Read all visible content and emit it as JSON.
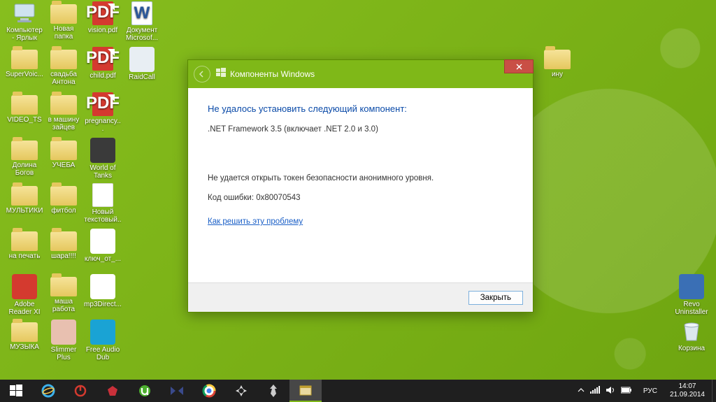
{
  "desktop_icons": [
    {
      "col": 0,
      "row": 0,
      "type": "pc",
      "label": "Компьютер - Ярлык",
      "name": "desktop-icon-computer"
    },
    {
      "col": 1,
      "row": 0,
      "type": "folder",
      "label": "Новая папка",
      "name": "desktop-icon-new-folder"
    },
    {
      "col": 2,
      "row": 0,
      "type": "pdf",
      "label": "vision.pdf",
      "name": "desktop-icon-vision-pdf"
    },
    {
      "col": 3,
      "row": 0,
      "type": "doc",
      "label": "Документ Microsof...",
      "name": "desktop-icon-word-doc"
    },
    {
      "col": 0,
      "row": 1,
      "type": "folder",
      "label": "SuperVoic...",
      "name": "desktop-icon-supervoice"
    },
    {
      "col": 1,
      "row": 1,
      "type": "folder",
      "label": "свадьба Антона",
      "name": "desktop-icon-wedding"
    },
    {
      "col": 2,
      "row": 1,
      "type": "pdf",
      "label": "child.pdf",
      "name": "desktop-icon-child-pdf"
    },
    {
      "col": 3,
      "row": 1,
      "type": "app",
      "label": "RaidCall",
      "name": "desktop-icon-raidcall",
      "bg": "#e8eef3"
    },
    {
      "col": 0,
      "row": 2,
      "type": "folder",
      "label": "VIDEO_TS",
      "name": "desktop-icon-video-ts"
    },
    {
      "col": 1,
      "row": 2,
      "type": "folder",
      "label": "в машину зайцев",
      "name": "desktop-icon-car"
    },
    {
      "col": 2,
      "row": 2,
      "type": "pdf",
      "label": "pregnancy...",
      "name": "desktop-icon-pregnancy-pdf"
    },
    {
      "col": 0,
      "row": 3,
      "type": "folder",
      "label": "Долина Богов",
      "name": "desktop-icon-valley"
    },
    {
      "col": 1,
      "row": 3,
      "type": "folder",
      "label": "УЧЕБА",
      "name": "desktop-icon-study"
    },
    {
      "col": 2,
      "row": 3,
      "type": "app",
      "label": "World of Tanks",
      "name": "desktop-icon-wot",
      "bg": "#3a3a3a"
    },
    {
      "col": 0,
      "row": 4,
      "type": "folder",
      "label": "МУЛЬТИКИ",
      "name": "desktop-icon-cartoons"
    },
    {
      "col": 1,
      "row": 4,
      "type": "folder",
      "label": "фитбол",
      "name": "desktop-icon-fitball"
    },
    {
      "col": 2,
      "row": 4,
      "type": "txt",
      "label": "Новый текстовый...",
      "name": "desktop-icon-txt"
    },
    {
      "col": 0,
      "row": 5,
      "type": "folder",
      "label": "на печать",
      "name": "desktop-icon-print"
    },
    {
      "col": 1,
      "row": 5,
      "type": "folder",
      "label": "шара!!!!",
      "name": "desktop-icon-shara"
    },
    {
      "col": 2,
      "row": 5,
      "type": "app",
      "label": "ключ_от_...",
      "name": "desktop-icon-key",
      "bg": "#fff"
    },
    {
      "col": 0,
      "row": 6,
      "type": "app",
      "label": "Adobe Reader XI",
      "name": "desktop-icon-adobe",
      "bg": "#d43a2f"
    },
    {
      "col": 1,
      "row": 6,
      "type": "folder",
      "label": "маша работа",
      "name": "desktop-icon-masha"
    },
    {
      "col": 2,
      "row": 6,
      "type": "app",
      "label": "mp3Direct...",
      "name": "desktop-icon-mp3",
      "bg": "#fff"
    },
    {
      "col": 0,
      "row": 7,
      "type": "folder",
      "label": "МУЗЫКА",
      "name": "desktop-icon-music"
    },
    {
      "col": 1,
      "row": 7,
      "type": "app",
      "label": "Slimmer Plus",
      "name": "desktop-icon-slimmer",
      "bg": "#e8c0b0"
    },
    {
      "col": 2,
      "row": 7,
      "type": "app",
      "label": "Free Audio Dub",
      "name": "desktop-icon-audiodub",
      "bg": "#1aa3d4"
    },
    {
      "col": 15,
      "row": 1,
      "type": "folder",
      "label": "ину",
      "name": "desktop-icon-right1"
    },
    {
      "col": 17,
      "row": 6,
      "type": "app",
      "label": "Revo Uninstaller",
      "name": "desktop-icon-revo",
      "bg": "#3a6fb5"
    },
    {
      "col": 17,
      "row": 7,
      "type": "bin",
      "label": "Корзина",
      "name": "desktop-icon-recyclebin"
    }
  ],
  "dialog": {
    "title": "Компоненты Windows",
    "heading": "Не удалось установить следующий компонент:",
    "component": ".NET Framework 3.5 (включает .NET 2.0 и 3.0)",
    "error_msg": "Не удается открыть токен безопасности анонимного уровня.",
    "error_code": "Код ошибки: 0x80070543",
    "help_link": "Как решить эту проблему",
    "close_label": "Закрыть"
  },
  "taskbar": {
    "lang": "РУС",
    "time": "14:07",
    "date": "21.09.2014"
  }
}
